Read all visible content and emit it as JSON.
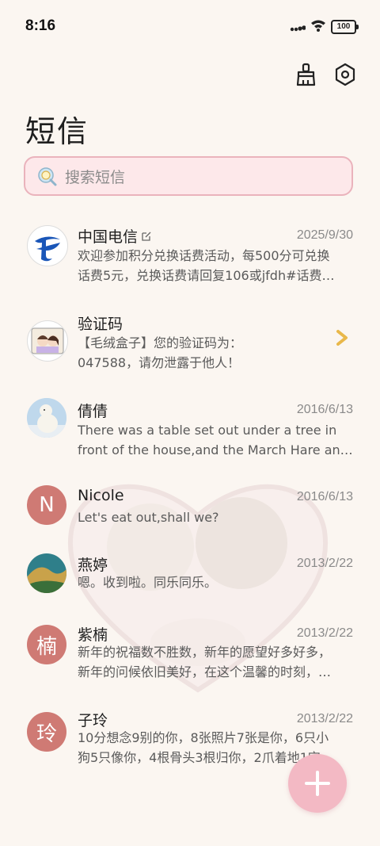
{
  "status": {
    "time": "8:16",
    "battery": "100"
  },
  "header": {
    "title": "短信"
  },
  "search": {
    "placeholder": "搜索短信"
  },
  "messages": [
    {
      "name": "中国电信",
      "date": "2025/9/30",
      "line1": "欢迎参加积分兑换话费活动，每500分可兑换",
      "line2": "话费5元，兑换话费请回复106或jfdh#话费…"
    },
    {
      "name": "验证码",
      "date": "",
      "line1": "【毛绒盒子】您的验证码为：",
      "line2": "047588，请勿泄露于他人！"
    },
    {
      "name": "倩倩",
      "date": "2016/6/13",
      "line1": "There was a table set out under a tree in",
      "line2": "front of the house,and the March Hare an…"
    },
    {
      "name": "Nicole",
      "date": "2016/6/13",
      "avatar_letter": "N",
      "line1": "Let's eat out,shall we?",
      "line2": ""
    },
    {
      "name": "燕婷",
      "date": "2013/2/22",
      "line1": "嗯。收到啦。同乐同乐。",
      "line2": ""
    },
    {
      "name": "紫楠",
      "date": "2013/2/22",
      "avatar_letter": "楠",
      "line1": "新年的祝福数不胜数，新年的愿望好多好多，",
      "line2": "新年的问候依旧美好，在这个温馨的时刻，…"
    },
    {
      "name": "子玲",
      "date": "2013/2/22",
      "avatar_letter": "玲",
      "line1": "10分想念9别的你，8张照片7张是你，6只小",
      "line2": "狗5只像你，4根骨头3根归你，2爪着地1定…"
    }
  ],
  "colors": {
    "accent": "#f3b9c4",
    "avatar": "#cf7a74",
    "background": "#fbf6f1"
  }
}
